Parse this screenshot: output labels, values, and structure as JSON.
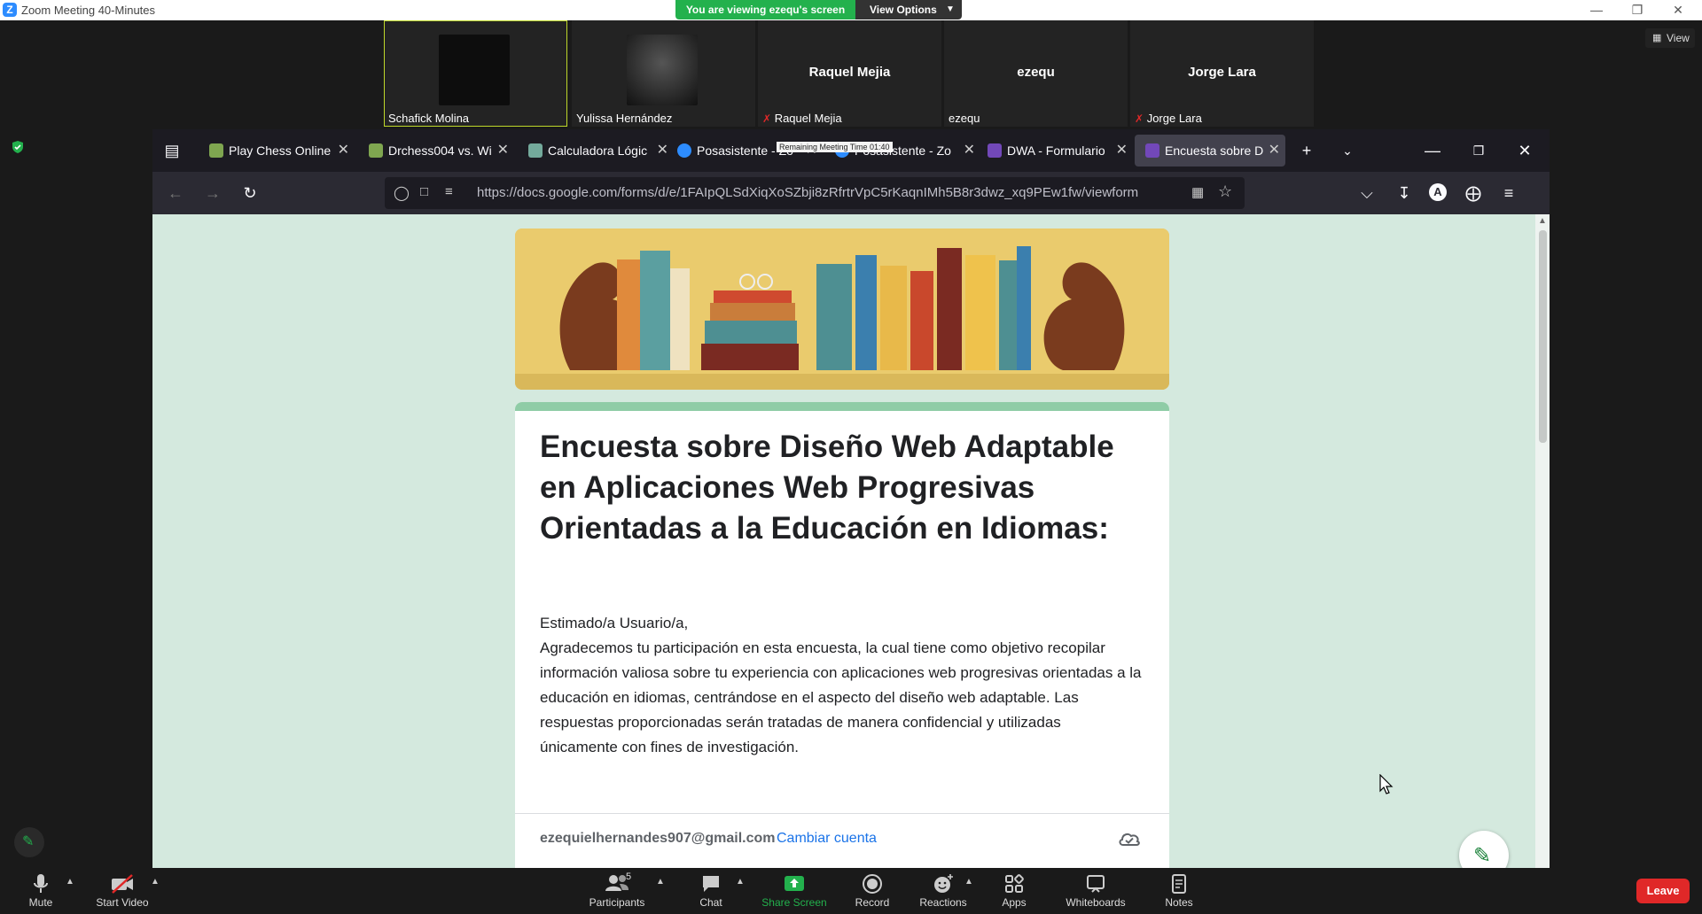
{
  "zoom": {
    "window_title": "Zoom Meeting 40-Minutes",
    "share_banner": "You are viewing ezequ's screen",
    "view_options_label": "View Options",
    "view_button_label": "View",
    "participants": [
      {
        "name": "Schafick Molina",
        "big_name": "",
        "muted": false,
        "video": true
      },
      {
        "name": "Yulissa Hernández",
        "big_name": "",
        "muted": false,
        "video": true
      },
      {
        "name": "Raquel Mejia",
        "big_name": "Raquel Mejia",
        "muted": true,
        "video": false
      },
      {
        "name": "ezequ",
        "big_name": "ezequ",
        "muted": false,
        "video": false
      },
      {
        "name": "Jorge Lara",
        "big_name": "Jorge Lara",
        "muted": true,
        "video": false
      }
    ],
    "toolbar": {
      "mute": "Mute",
      "start_video": "Start Video",
      "participants": "Participants",
      "participants_count": "5",
      "chat": "Chat",
      "share_screen": "Share Screen",
      "record": "Record",
      "reactions": "Reactions",
      "apps": "Apps",
      "whiteboards": "Whiteboards",
      "notes": "Notes",
      "leave": "Leave"
    },
    "tooltip": "Remaining Meeting Time 01:40"
  },
  "browser": {
    "tabs": [
      {
        "label": "Play Chess Online",
        "icon": "chess-pawn-icon",
        "color": "#7fa650",
        "active": false
      },
      {
        "label": "Drchess004 vs. Wi",
        "icon": "chess-pawn-icon",
        "color": "#7fa650",
        "active": false
      },
      {
        "label": "Calculadora Lógic",
        "icon": "chatgpt-icon",
        "color": "#74aa9c",
        "active": false
      },
      {
        "label": "Posasistente - Zo",
        "icon": "zoom-icon",
        "color": "#2D8CFF",
        "active": false
      },
      {
        "label": "Posasistente - Zo",
        "icon": "zoom-icon",
        "color": "#2D8CFF",
        "active": false
      },
      {
        "label": "DWA - Formulario",
        "icon": "forms-icon",
        "color": "#7248b9",
        "active": false
      },
      {
        "label": "Encuesta sobre Di",
        "icon": "forms-icon",
        "color": "#7248b9",
        "active": true
      }
    ],
    "url": "https://docs.google.com/forms/d/e/1FAIpQLSdXiqXoSZbji8zRfrtrVpC5rKaqnIMh5B8r3dwz_xq9PEw1fw/viewform"
  },
  "form": {
    "title": "Encuesta sobre Diseño Web Adaptable en Aplicaciones Web Progresivas Orientadas a la Educación en Idiomas:",
    "greeting": "Estimado/a Usuario/a,",
    "description": "Agradecemos tu participación en esta encuesta, la cual tiene como objetivo recopilar información valiosa sobre tu experiencia con aplicaciones web progresivas orientadas a la educación en idiomas, centrándose en el aspecto del diseño web adaptable. Las respuestas proporcionadas serán tratadas de manera confidencial y utilizadas únicamente con fines de investigación.",
    "account_email": "ezequielhernandes907@gmail.com",
    "switch_account": "Cambiar cuenta"
  },
  "colors": {
    "page_bg": "#d4e9de",
    "form_accent": "#8fcca6",
    "zoom_blue": "#2D8CFF",
    "share_green": "#23b14d",
    "leave_red": "#e02828"
  }
}
